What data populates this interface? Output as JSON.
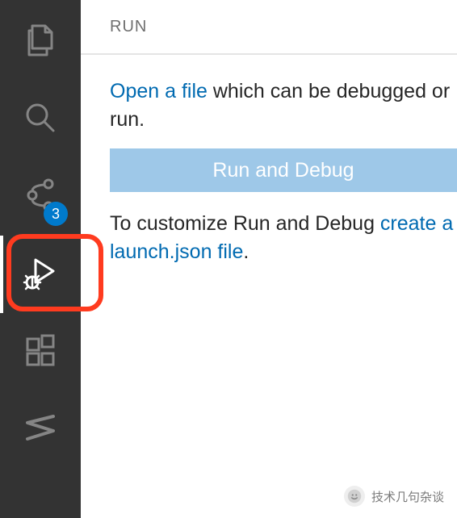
{
  "activityBar": {
    "items": [
      {
        "name": "explorer",
        "icon": "files-icon",
        "active": false,
        "badge": null
      },
      {
        "name": "search",
        "icon": "search-icon",
        "active": false,
        "badge": null
      },
      {
        "name": "sourceControl",
        "icon": "source-control-icon",
        "active": false,
        "badge": "3"
      },
      {
        "name": "runDebug",
        "icon": "run-debug-icon",
        "active": true,
        "badge": null,
        "highlighted": true
      },
      {
        "name": "extensions",
        "icon": "extensions-icon",
        "active": false,
        "badge": null
      },
      {
        "name": "custom",
        "icon": "custom-s-icon",
        "active": false,
        "badge": null
      }
    ],
    "badgeValue": "3"
  },
  "panel": {
    "title": "RUN",
    "openFileLink": "Open a file",
    "openFileTail": " which can be debugged or run.",
    "runButton": "Run and Debug",
    "customizeLead": "To customize Run and Debug ",
    "createLaunchLink": "create a launch.json file",
    "period": "."
  },
  "watermark": {
    "text": "技术几句杂谈"
  },
  "colors": {
    "accent": "#007acc",
    "link": "#006ab1",
    "highlight": "#ff3b1f",
    "buttonBg": "#9ec8e8"
  }
}
